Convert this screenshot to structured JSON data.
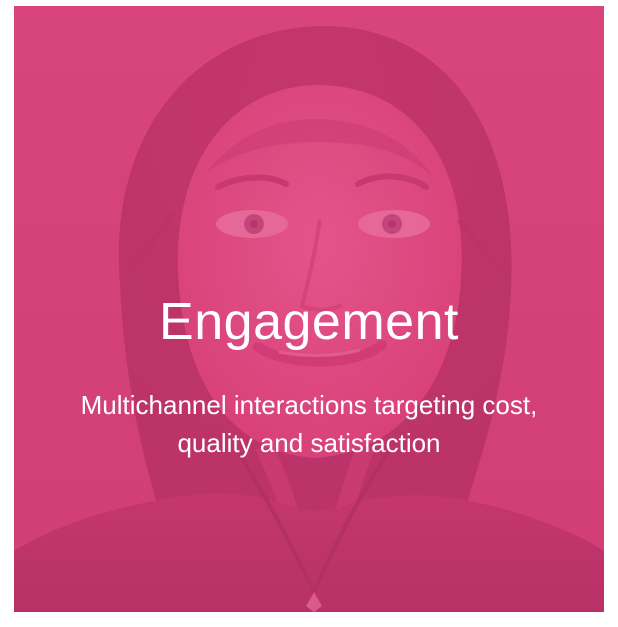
{
  "card": {
    "overlay_color": "#e0417d",
    "title": "Engagement",
    "subtitle_lines": [
      "Multichannel interactions targeting cost,",
      "quality and satisfaction"
    ]
  }
}
